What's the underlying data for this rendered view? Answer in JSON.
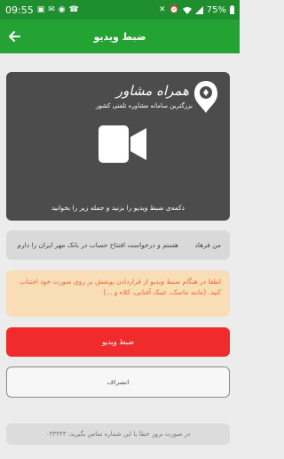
{
  "status_bar": {
    "time": "09:55",
    "battery": "75%",
    "left_icons": [
      "gallery-icon",
      "message-icon",
      "whatsapp-icon",
      "phone-icon"
    ],
    "right_icons": [
      "mute-icon",
      "alarm-icon",
      "wifi-icon",
      "signal-icon",
      "battery-icon"
    ]
  },
  "app_bar": {
    "title": "ضبط ویدیو",
    "color": "#24a334"
  },
  "video": {
    "logo_title": "همراه مشاور",
    "logo_subtitle": "بزرگترین سامانه مشاوره تلفنی کشور",
    "instruction": "دکمه‌ی ضبط ویدیو را بزنید و جمله زیر را بخوانید",
    "icon": "video-camera-icon"
  },
  "phrase": {
    "name": "من فرهاد",
    "text": "هستم و درخواست افتتاح حساب در بانک مهر ایران را دارم"
  },
  "warning": {
    "text": "لطفا در هنگام ضبط ویدیو از قراردادن پوشش بر روی صورت خود اجتناب کنید. (مانند ماسک، عینک آفتابی، کلاه و ...)"
  },
  "buttons": {
    "record": "ضبط ویدیو",
    "cancel": "انصراف"
  },
  "footer": {
    "text": "در صورت بروز خطا با این شماره تماس بگیرید: ۰۳۳۳۳۳"
  },
  "colors": {
    "record": "#ef2b2b",
    "warning_bg": "#f8ddb7",
    "warning_text": "#e86a2b"
  }
}
